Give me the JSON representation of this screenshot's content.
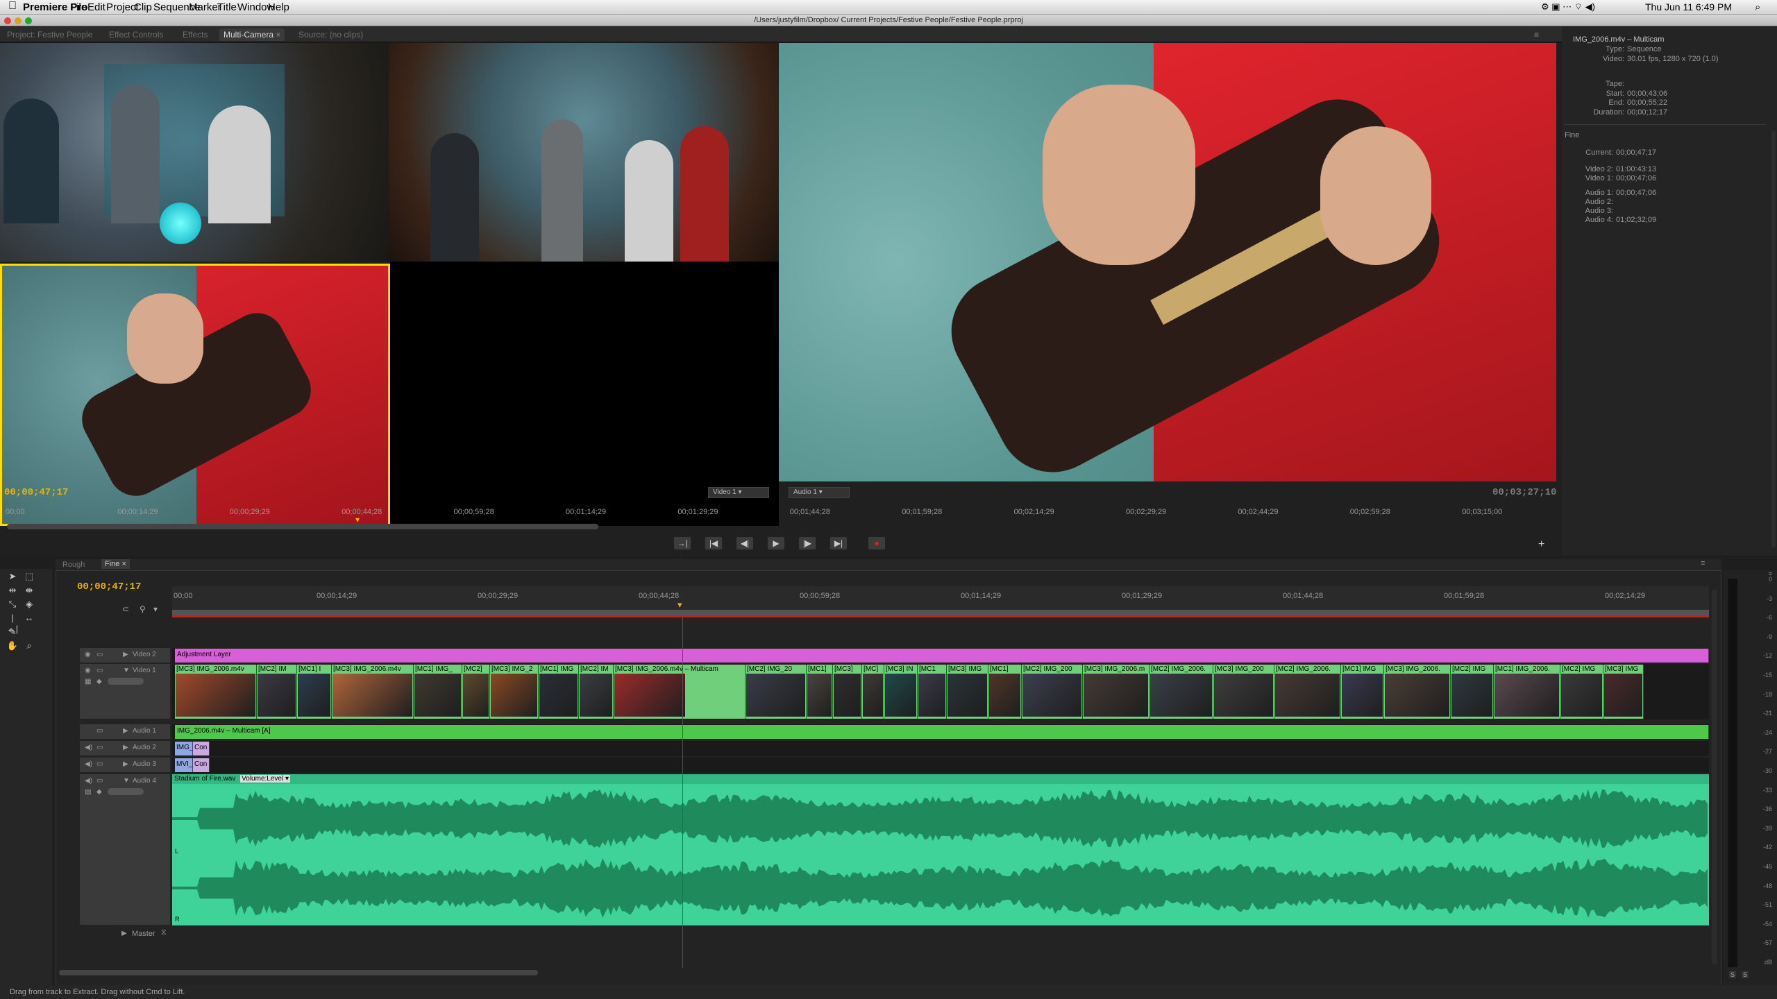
{
  "menubar": {
    "apple": "",
    "app": "Premiere Pro",
    "items": [
      "File",
      "Edit",
      "Project",
      "Clip",
      "Sequence",
      "Marker",
      "Title",
      "Window",
      "Help"
    ],
    "clock": "Thu Jun 11  6:49 PM"
  },
  "window": {
    "title": "/Users/justyfilm/Dropbox/ Current Projects/Festive People/Festive People.prproj"
  },
  "panel_tabs": [
    {
      "label": "Project: Festive People"
    },
    {
      "label": "Effect Controls"
    },
    {
      "label": "Effects"
    },
    {
      "label": "Multi-Camera"
    },
    {
      "label": "Source: (no clips)"
    }
  ],
  "multicam": {
    "timecode_current": "00;00;47;17",
    "timecode_duration": "00;03;27;10",
    "video_select": "Video 1",
    "audio_select": "Audio 1",
    "ruler": [
      "00;00",
      "00;00;14;29",
      "00;00;29;29",
      "00;00;44;28",
      "00;00;59;28",
      "00;01;14;29",
      "00;01;29;29",
      "00;01;44;28",
      "00;01;59;28",
      "00;02;14;29",
      "00;02;29;29",
      "00;02;44;29",
      "00;02;59;28",
      "00;03;15;00"
    ],
    "transport": {
      "icons": [
        "loop-in-out-icon",
        "go-to-in-icon",
        "step-back-icon",
        "play-icon",
        "step-forward-icon",
        "go-to-out-icon",
        "record-icon"
      ],
      "glyphs": [
        "→|←",
        "|◀",
        "◀|",
        "▶",
        "|▶",
        "▶|",
        "●"
      ]
    },
    "add_button": "+"
  },
  "info": {
    "clip_name": "IMG_2006.m4v – Multicam",
    "type_label": "Type:",
    "type": "Sequence",
    "video_label": "Video:",
    "video": "30.01 fps, 1280 x 720 (1.0)",
    "tape_label": "Tape:",
    "start_label": "Start:",
    "start": "00;00;43;06",
    "end_label": "End:",
    "end": "00;00;55;22",
    "duration_label": "Duration:",
    "duration": "00;00;12;17",
    "section": "Fine",
    "current_label": "Current:",
    "current": "00;00;47;17",
    "video2_label": "Video 2:",
    "video2": "01:00:43:13",
    "video1_label": "Video 1:",
    "video1": "00;00;47;06",
    "audio1_label": "Audio 1:",
    "audio1": "00;00;47;06",
    "audio2_label": "Audio 2:",
    "audio3_label": "Audio 3:",
    "audio4_label": "Audio 4:",
    "audio4": "01;02;32;09"
  },
  "timeline": {
    "tabs": [
      {
        "label": "Rough"
      },
      {
        "label": "Fine"
      }
    ],
    "timecode": "00;00;47;17",
    "ruler": [
      "00;00",
      "00;00;14;29",
      "00;00;29;29",
      "00;00;44;28",
      "00;00;59;28",
      "00;01;14;29",
      "00;01;29;29",
      "00;01;44;28",
      "00;01;59;28",
      "00;02;14;29"
    ],
    "tracks": {
      "video2": "Video 2",
      "video1": "Video 1",
      "audio1": "Audio 1",
      "audio2": "Audio 2",
      "audio3": "Audio 3",
      "audio4": "Audio 4",
      "master": "Master"
    },
    "clips": {
      "adjustment": "Adjustment Layer",
      "audio1": "IMG_2006.m4v – Multicam [A]",
      "audio2": "IMG_",
      "audio2b": "Con",
      "audio3": "MVI_(",
      "audio3b": "Con",
      "audio4": "Stadium of Fire.wav",
      "audio4_fx": "Volume:Level ▾",
      "channel_l": "L",
      "channel_r": "R"
    },
    "v1_clips": [
      {
        "label": "[MC3] IMG_2006.m4v"
      },
      {
        "label": "[MC2] IM"
      },
      {
        "label": "[MC1] I"
      },
      {
        "label": "[MC3] IMG_2006.m4v"
      },
      {
        "label": "[MC1] IMG_"
      },
      {
        "label": "[MC2]"
      },
      {
        "label": "[MC3] IMG_2"
      },
      {
        "label": "[MC1] IMG"
      },
      {
        "label": "[MC2] IM"
      },
      {
        "label": "[MC3] IMG_2006.m4v – Multicam"
      },
      {
        "label": "[MC2] IMG_20"
      },
      {
        "label": "[MC1]"
      },
      {
        "label": "[MC3]"
      },
      {
        "label": "[MC]"
      },
      {
        "label": "[MC3] IN"
      },
      {
        "label": "[MC1"
      },
      {
        "label": "[MC3] IMG"
      },
      {
        "label": "[MC1]"
      },
      {
        "label": "[MC2] IMG_200"
      },
      {
        "label": "[MC3] IMG_2006.m"
      },
      {
        "label": "[MC2] IMG_2006."
      },
      {
        "label": "[MC3] IMG_200"
      },
      {
        "label": "[MC2] IMG_2006."
      },
      {
        "label": "[MC1] IMG"
      },
      {
        "label": "[MC3] IMG_2006."
      },
      {
        "label": "[MC2] IMG"
      },
      {
        "label": "[MC1] IMG_2006."
      },
      {
        "label": "[MC2] IMG"
      },
      {
        "label": "[MC3] IMG"
      }
    ],
    "meter_ticks": [
      "0",
      "-3",
      "-6",
      "-9",
      "-12",
      "-15",
      "-18",
      "-21",
      "-24",
      "-27",
      "-30",
      "-33",
      "-36",
      "-39",
      "-42",
      "-45",
      "-48",
      "-51",
      "-54",
      "-57",
      "dB"
    ],
    "meter_buttons": [
      "S",
      "S"
    ]
  },
  "status": {
    "text": "Drag from track to Extract. Drag without Cmd to Lift."
  },
  "colors": {
    "timecode": "#e8b400",
    "selection": "#ffdd00",
    "adjustment": "#d75fd7",
    "video_clip": "#6fcf7a",
    "audio_clip": "#4ec88a",
    "audio_bg": "#3fd39a",
    "playhead": "#c82020"
  }
}
